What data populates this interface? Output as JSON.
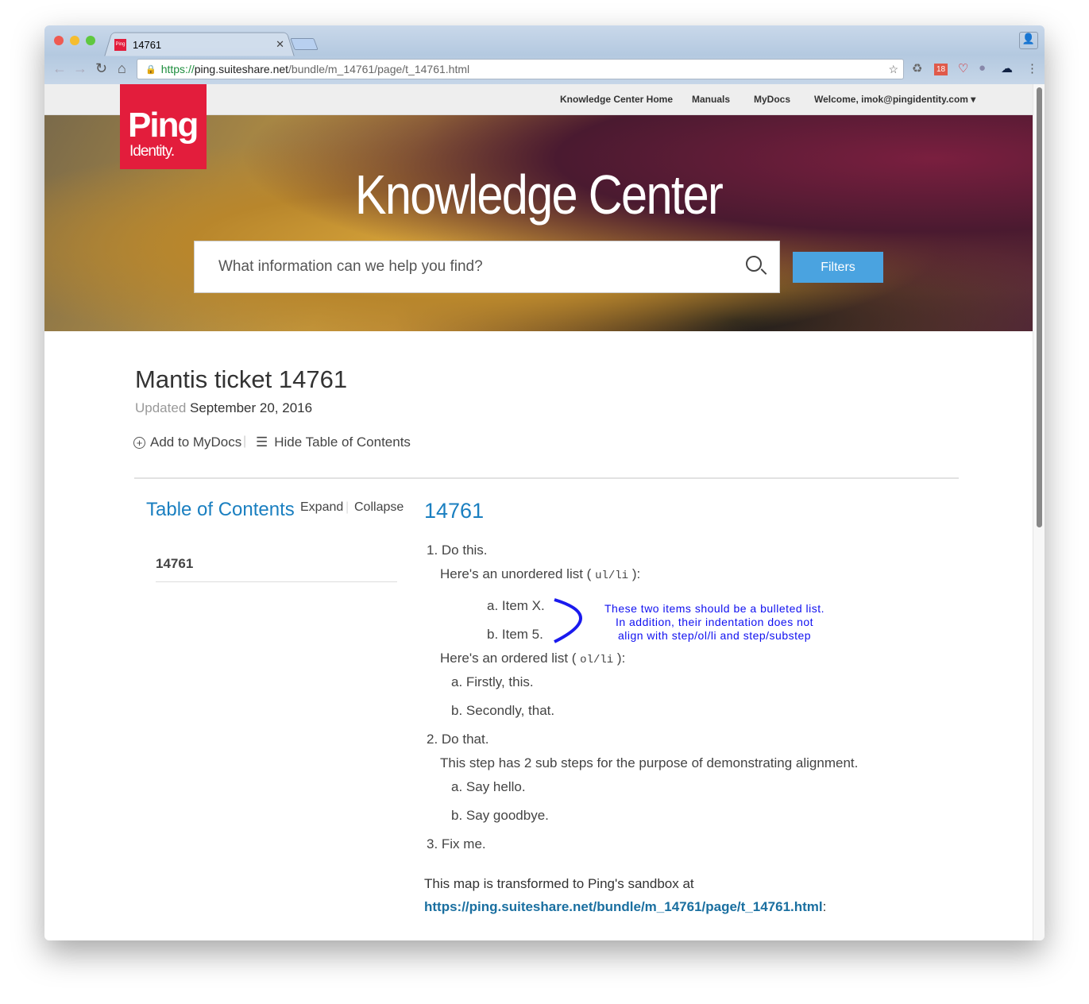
{
  "browser": {
    "tab_title": "14761",
    "url_scheme": "https://",
    "url_host": "ping.suiteshare.net",
    "url_path": "/bundle/m_14761/page/t_14761.html",
    "badge_count": "18"
  },
  "nav": {
    "items": [
      "Knowledge Center Home",
      "Manuals",
      "MyDocs"
    ],
    "welcome": "Welcome, imok@pingidentity.com"
  },
  "logo": {
    "line1": "Ping",
    "line2": "Identity."
  },
  "hero": {
    "title": "Knowledge Center",
    "search_placeholder": "What information can we help you find?",
    "filters": "Filters"
  },
  "doc": {
    "title": "Mantis ticket 14761",
    "updated_label": "Updated",
    "updated_date": "September 20, 2016",
    "add_mydocs": "Add to MyDocs",
    "hide_toc": "Hide Table of Contents"
  },
  "toc": {
    "title": "Table of Contents",
    "expand": "Expand",
    "collapse": "Collapse",
    "items": [
      "14761"
    ]
  },
  "content": {
    "heading": "14761",
    "s1": "1. Do this.",
    "s1_ul_pre": "Here's an unordered list (",
    "s1_ul_code": "ul/li",
    "s1_ul_post": "):",
    "ul_a": "a. Item X.",
    "ul_b": "b. Item 5.",
    "s1_ol_pre": "Here's an ordered list (",
    "s1_ol_code": "ol/li",
    "s1_ol_post": "):",
    "ol_a": "a. Firstly, this.",
    "ol_b": "b. Secondly, that.",
    "s2": "2. Do that.",
    "s2_info": "This step has 2 sub steps for the purpose of demonstrating alignment.",
    "s2_a": "a. Say hello.",
    "s2_b": "b. Say goodbye.",
    "s3": "3. Fix me.",
    "footer_text": "This map is transformed to Ping's sandbox at",
    "footer_link": "https://ping.suiteshare.net/bundle/m_14761/page/t_14761.html"
  },
  "annotation": {
    "line1": "These two items should be a bulleted list.",
    "line2": "In addition, their indentation does not",
    "line3": "align with step/ol/li and step/substep"
  }
}
